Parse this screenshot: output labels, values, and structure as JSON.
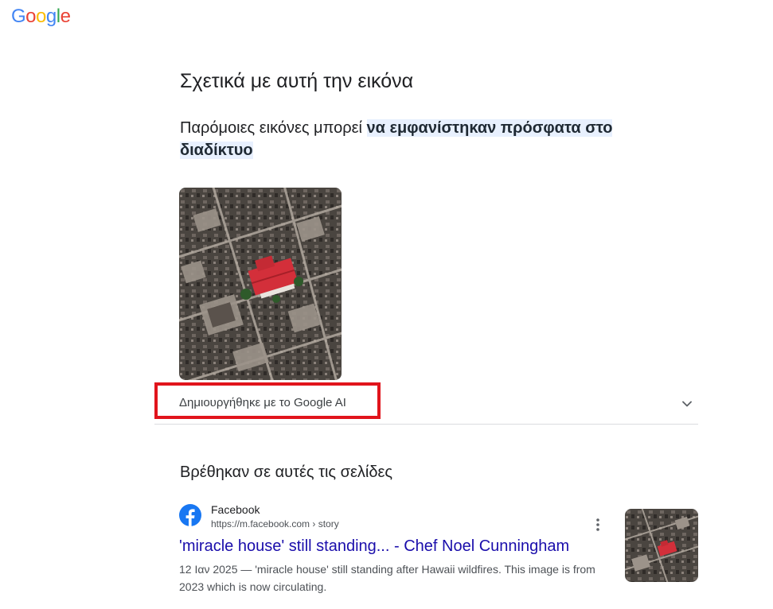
{
  "logo": {
    "letters": [
      "G",
      "o",
      "o",
      "g",
      "l",
      "e"
    ],
    "colors": [
      "#4285F4",
      "#EA4335",
      "#FBBC05",
      "#4285F4",
      "#34A853",
      "#EA4335"
    ]
  },
  "about": {
    "title": "Σχετικά με αυτή την εικόνα",
    "subtitle_plain": "Παρόμοιες εικόνες μπορεί ",
    "subtitle_highlight": "να εμφανίστηκαν πρόσφατα στο διαδίκτυο"
  },
  "ai_section": {
    "label": "Δημιουργήθηκε με το Google AI",
    "expand_icon": "chevron-down-icon",
    "highlight_color": "#e1141c"
  },
  "pages": {
    "heading": "Βρέθηκαν σε αυτές τις σελίδες",
    "results": [
      {
        "site": "Facebook",
        "url": "https://m.facebook.com › story",
        "title": "'miracle house' still standing... - Chef Noel Cunningham",
        "snippet": "12 Ιαν 2025 — 'miracle house' still standing after Hawaii wildfires. This image is from 2023 which is now circulating.",
        "icon": "facebook-icon",
        "icon_color": "#1877F2"
      }
    ]
  },
  "colors": {
    "link": "#1a0dab",
    "highlight_bg": "#e8f0fe"
  }
}
